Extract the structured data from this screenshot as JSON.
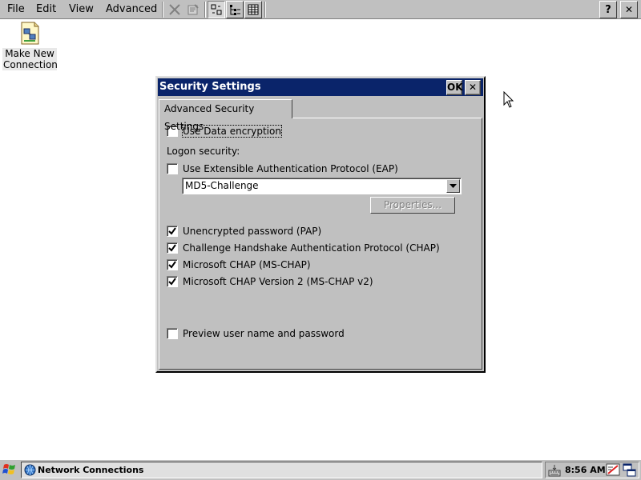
{
  "menubar": {
    "items": [
      {
        "label": "File"
      },
      {
        "label": "Edit"
      },
      {
        "label": "View"
      },
      {
        "label": "Advanced"
      }
    ],
    "tools": [
      "delete-icon",
      "properties-icon",
      "large-icons-view-icon",
      "list-view-icon",
      "details-view-icon"
    ],
    "help_label": "?",
    "close_label": "✕"
  },
  "desktop_icon": {
    "line1": "Make New",
    "line2": "Connection",
    "icon": "network-connection-icon"
  },
  "dialog": {
    "title": "Security Settings",
    "ok_label": "OK",
    "close_label": "✕",
    "tab_label": "Advanced Security Settings",
    "use_encryption": {
      "label": "Use Data encryption",
      "checked": false
    },
    "logon_security_label": "Logon security:",
    "use_eap": {
      "label": "Use Extensible Authentication Protocol (EAP)",
      "checked": false
    },
    "eap_selected": "MD5-Challenge",
    "properties_label": "Properties...",
    "pap": {
      "label": "Unencrypted password (PAP)",
      "checked": true
    },
    "chap": {
      "label": "Challenge Handshake Authentication Protocol (CHAP)",
      "checked": true
    },
    "mschap": {
      "label": "Microsoft CHAP (MS-CHAP)",
      "checked": true
    },
    "mschap2": {
      "label": "Microsoft CHAP Version 2 (MS-CHAP v2)",
      "checked": true
    },
    "preview": {
      "label": "Preview user name and password",
      "checked": false
    }
  },
  "taskbar": {
    "task_label": "Network Connections",
    "clock": "8:56 AM"
  }
}
